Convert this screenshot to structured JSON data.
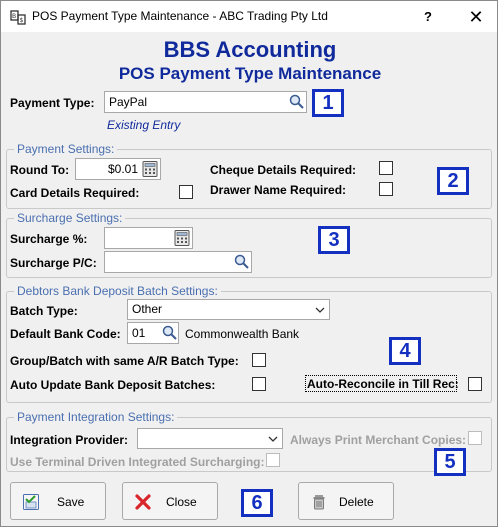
{
  "window": {
    "title": "POS Payment Type Maintenance - ABC Trading Pty Ltd",
    "help_label": "?",
    "close_label": "✕"
  },
  "heading": {
    "company": "BBS Accounting",
    "form": "POS Payment Type Maintenance"
  },
  "payment_type": {
    "label": "Payment Type:",
    "value": "PayPal",
    "status": "Existing Entry",
    "badge": "1"
  },
  "payment_settings": {
    "legend": "Payment Settings:",
    "round_to_label": "Round To:",
    "round_to_value": "$0.01",
    "card_details_label": "Card Details Required:",
    "cheque_details_label": "Cheque Details Required:",
    "drawer_name_label": "Drawer Name Required:",
    "badge": "2"
  },
  "surcharge_settings": {
    "legend": "Surcharge Settings:",
    "percent_label": "Surcharge %:",
    "percent_value": "",
    "pc_label": "Surcharge P/C:",
    "pc_value": "",
    "badge": "3"
  },
  "bank_deposit": {
    "legend": "Debtors Bank Deposit Batch Settings:",
    "batch_type_label": "Batch Type:",
    "batch_type_value": "Other",
    "bank_code_label": "Default Bank Code:",
    "bank_code_value": "01",
    "bank_name": "Commonwealth Bank",
    "group_batch_label": "Group/Batch with same A/R Batch Type:",
    "auto_update_label": "Auto Update Bank Deposit Batches:",
    "auto_reconcile_label": "Auto-Reconcile in Till Rec:",
    "badge": "4"
  },
  "integration": {
    "legend": "Payment Integration Settings:",
    "provider_label": "Integration Provider:",
    "provider_value": "",
    "always_print_label": "Always Print Merchant Copies:",
    "terminal_surcharge_label": "Use Terminal Driven Integrated Surcharging:",
    "badge": "5"
  },
  "buttons": {
    "save": "Save",
    "close": "Close",
    "delete": "Delete",
    "badge": "6"
  },
  "colors": {
    "heading": "#102a9c",
    "legend": "#4a6fb0",
    "badge_border": "#1330c0"
  }
}
